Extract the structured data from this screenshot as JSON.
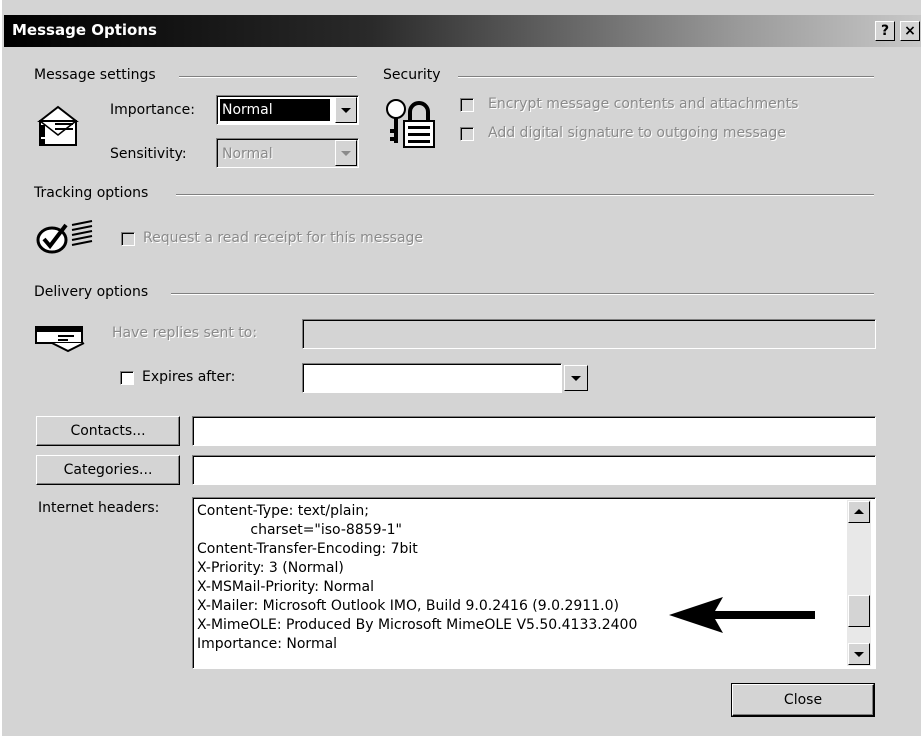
{
  "window": {
    "title": "Message Options",
    "help_label": "?",
    "close_label": "×"
  },
  "message_settings": {
    "group_label": "Message settings",
    "importance_label": "Importance:",
    "importance_value": "Normal",
    "sensitivity_label": "Sensitivity:",
    "sensitivity_value": "Normal"
  },
  "security": {
    "group_label": "Security",
    "encrypt_label": "Encrypt message contents and attachments",
    "signature_label": "Add digital signature to outgoing message"
  },
  "tracking": {
    "group_label": "Tracking options",
    "read_receipt_label": "Request a read receipt for this message"
  },
  "delivery": {
    "group_label": "Delivery options",
    "replies_label": "Have replies sent to:",
    "replies_value": "",
    "expires_label": "Expires after:",
    "expires_value": ""
  },
  "contacts": {
    "button_label": "Contacts...",
    "value": ""
  },
  "categories": {
    "button_label": "Categories...",
    "value": ""
  },
  "internet_headers": {
    "label": "Internet headers:",
    "text": "Content-Type: text/plain;\n            charset=\"iso-8859-1\"\nContent-Transfer-Encoding: 7bit\nX-Priority: 3 (Normal)\nX-MSMail-Priority: Normal\nX-Mailer: Microsoft Outlook IMO, Build 9.0.2416 (9.0.2911.0)\nX-MimeOLE: Produced By Microsoft MimeOLE V5.50.4133.2400\nImportance: Normal"
  },
  "footer": {
    "close_label": "Close"
  },
  "icons": {
    "message_settings": "envelope-important-icon",
    "security": "keys-lock-icon",
    "tracking": "checkmark-receipt-icon",
    "delivery": "reply-envelope-icon",
    "annotation": "arrow-left-icon"
  }
}
